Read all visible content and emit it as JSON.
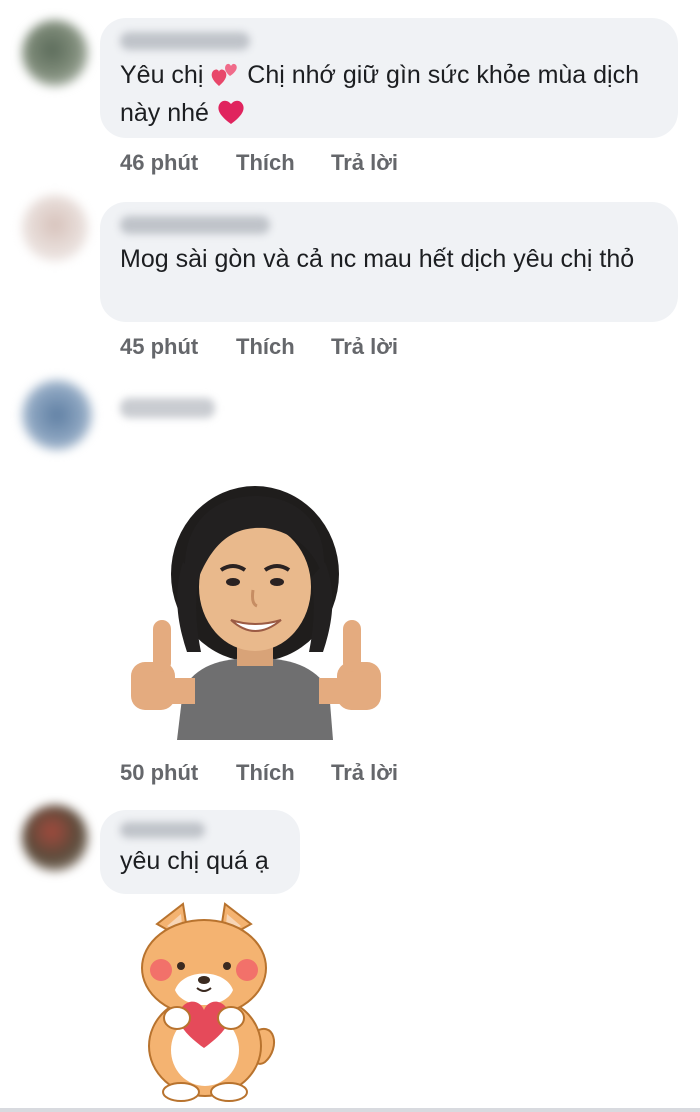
{
  "comments": [
    {
      "text_before": "Yêu chị ",
      "text_after": " Chị nhớ giữ gìn sức khỏe mùa dịch này nhé ",
      "time": "46 phút",
      "like": "Thích",
      "reply": "Trả lời"
    },
    {
      "text": "Mog sài gòn và cả nc mau hết dịch yêu chị thỏ",
      "time": "45 phút",
      "like": "Thích",
      "reply": "Trả lời"
    },
    {
      "sticker": "memoji-thumbs-up-sticker",
      "time": "50 phút",
      "like": "Thích",
      "reply": "Trả lời"
    },
    {
      "text": "yêu chị quá ạ",
      "sticker": "shiba-dog-heart-sticker"
    }
  ],
  "colors": {
    "bubble": "#f0f2f5",
    "action_text": "#65676b",
    "heart": "#e0245e"
  }
}
